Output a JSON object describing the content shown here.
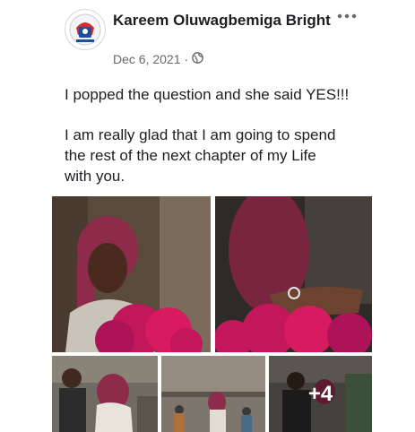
{
  "post": {
    "author": "Kareem Oluwagbemiga Bright",
    "date": "Dec 6, 2021",
    "separator": "·",
    "privacy_icon": "globe-icon",
    "more_icon": "more-dots-icon",
    "line1": "I popped the question and she said YES!!!",
    "line2": "I am really glad that I am going to spend",
    "line3": "the rest of the next chapter of my Life",
    "line4": "with you."
  },
  "gallery": {
    "more_count": "+4"
  },
  "colors": {
    "text": "#1c1e21",
    "meta": "#65676b",
    "roses": "#c2185b",
    "hair": "#8e2a4a"
  }
}
